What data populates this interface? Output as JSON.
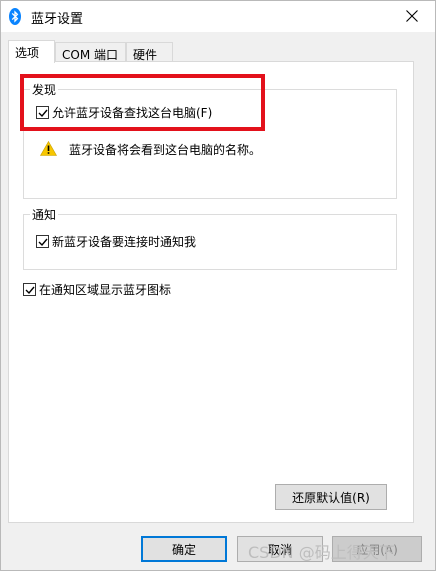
{
  "window": {
    "title": "蓝牙设置",
    "close_label": "关闭"
  },
  "tabs": [
    {
      "label": "选项",
      "active": true
    },
    {
      "label": "COM 端口",
      "active": false
    },
    {
      "label": "硬件",
      "active": false
    }
  ],
  "discovery": {
    "legend": "发现",
    "allow_discover_label": "允许蓝牙设备查找这台电脑(F)",
    "allow_discover_checked": true,
    "warning_text": "蓝牙设备将会看到这台电脑的名称。"
  },
  "notifications": {
    "legend": "通知",
    "notify_new_device_label": "新蓝牙设备要连接时通知我",
    "notify_new_device_checked": true
  },
  "show_tray_icon_label": "在通知区域显示蓝牙图标",
  "show_tray_icon_checked": true,
  "buttons": {
    "restore_defaults": "还原默认值(R)",
    "ok": "确定",
    "cancel": "取消",
    "apply": "应用(A)"
  },
  "watermark": "CSDN @码上得天下",
  "colors": {
    "highlight": "#e3111b",
    "accent": "#0078d7",
    "bluetooth": "#0a84ff"
  }
}
